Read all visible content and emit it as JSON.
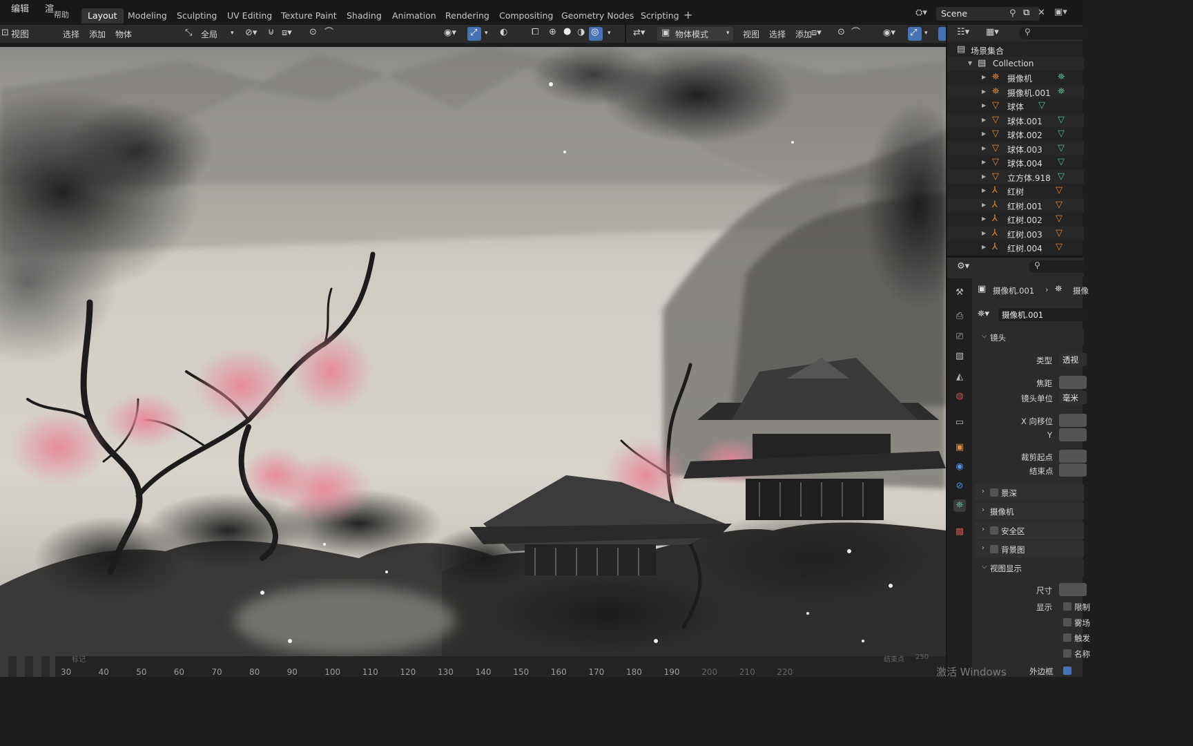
{
  "menubar": {
    "edit": "编辑",
    "render": "渲",
    "help": "帮助",
    "workspace_tabs": [
      "Layout",
      "Modeling",
      "Sculpting",
      "UV Editing",
      "Texture Paint",
      "Shading",
      "Animation",
      "Rendering",
      "Compositing",
      "Geometry Nodes",
      "Scripting"
    ],
    "active_tab": "Layout",
    "add_workspace": "+",
    "scene_name": "Scene"
  },
  "left_header": {
    "view": "视图"
  },
  "viewport_header": {
    "select": "选择",
    "add": "添加",
    "object": "物体",
    "transform_orientation": "全局"
  },
  "second_header": {
    "mode": "物体模式",
    "view": "视图",
    "select": "选择",
    "add": "添加"
  },
  "timeline": {
    "ticks": [
      "30",
      "40",
      "50",
      "60",
      "70",
      "80",
      "90",
      "100",
      "110",
      "120",
      "130",
      "140",
      "150",
      "160",
      "170",
      "180",
      "190",
      "200",
      "210",
      "220"
    ],
    "end_frame": "250",
    "markers": "标记",
    "end_label": "结束点"
  },
  "outliner": {
    "root": "场景集合",
    "collection": "Collection",
    "items": [
      {
        "name": "摄像机",
        "type": "camera"
      },
      {
        "name": "摄像机.001",
        "type": "camera"
      },
      {
        "name": "球体",
        "type": "mesh"
      },
      {
        "name": "球体.001",
        "type": "mesh"
      },
      {
        "name": "球体.002",
        "type": "mesh"
      },
      {
        "name": "球体.003",
        "type": "mesh"
      },
      {
        "name": "球体.004",
        "type": "mesh"
      },
      {
        "name": "立方体.918",
        "type": "mesh"
      },
      {
        "name": "红树",
        "type": "armature"
      },
      {
        "name": "红树.001",
        "type": "armature"
      },
      {
        "name": "红树.002",
        "type": "armature"
      },
      {
        "name": "红树.003",
        "type": "armature"
      },
      {
        "name": "红树.004",
        "type": "armature"
      }
    ]
  },
  "properties": {
    "breadcrumb_object": "摄像机.001",
    "breadcrumb_data": "摄像",
    "data_name": "摄像机.001",
    "lens_panel": "镜头",
    "type_label": "类型",
    "type_value": "透视",
    "focal_label": "焦距",
    "lens_unit_label": "镜头单位",
    "lens_unit_value": "毫米",
    "shift_x_label": "X 向移位",
    "shift_y_label": "Y",
    "clip_start_label": "裁剪起点",
    "clip_end_label": "结束点",
    "sections": [
      "景深",
      "摄像机",
      "安全区",
      "背景图"
    ],
    "viewport_display": "视图显示",
    "size_label": "尺寸",
    "show_label": "显示",
    "show_options": [
      "限制",
      "雾场",
      "触发",
      "名称"
    ],
    "passepartout_label": "外边框"
  },
  "watermark": "激活 Windows",
  "colors": {
    "accent_blue": "#4772b3",
    "object_orange": "#e08a3c",
    "data_green": "#5ab98c"
  }
}
